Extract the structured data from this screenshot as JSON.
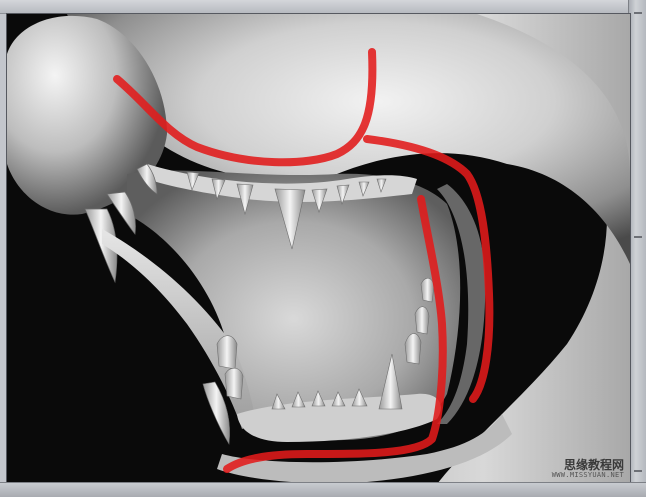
{
  "watermark": {
    "site_name": "思缘教程网",
    "site_url": "WWW.MISSYUAN.NET"
  },
  "colors": {
    "frame": "#c3c6cc",
    "viewport_bg": "#0c0c0c",
    "annotation_stroke": "#e21b1b"
  },
  "icons": [
    "viewport-frame"
  ]
}
